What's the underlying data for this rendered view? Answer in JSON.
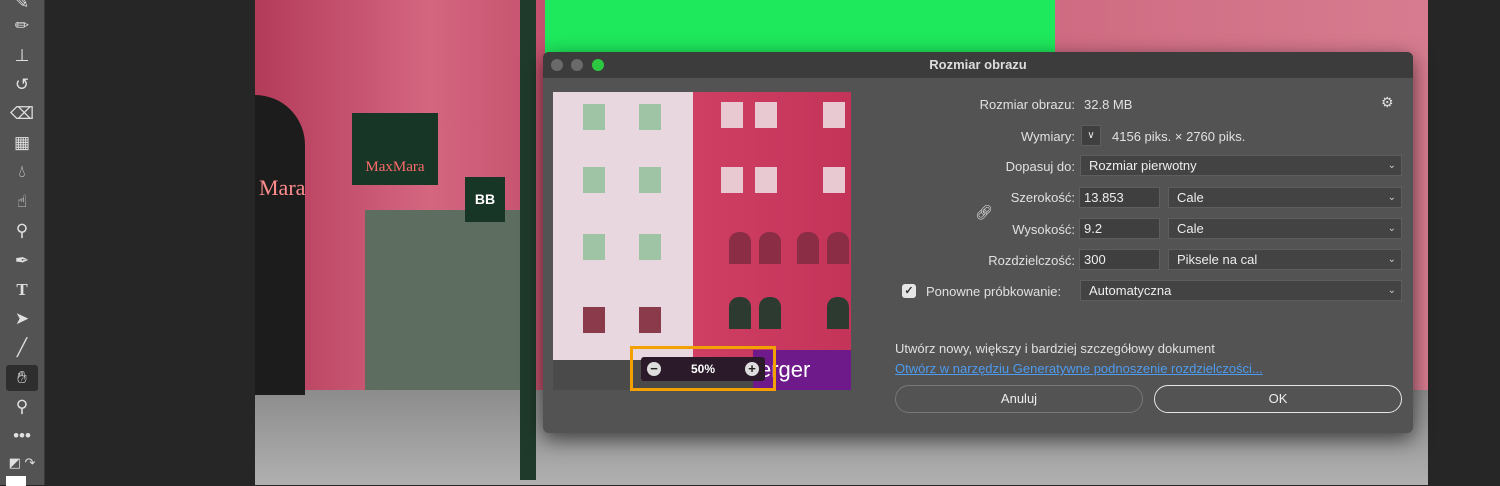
{
  "toolbar": {
    "tools": [
      "brush",
      "pencil",
      "stamp",
      "history-brush",
      "eraser",
      "gradient",
      "blur",
      "smudge",
      "dodge",
      "pen",
      "type",
      "path-selection",
      "line",
      "hand",
      "zoom",
      "more",
      "swap-colors"
    ],
    "active": "hand",
    "type_glyph": "T"
  },
  "dialog": {
    "title": "Rozmiar obrazu",
    "image_size_label": "Rozmiar obrazu:",
    "image_size_value": "32.8 MB",
    "dimensions_label": "Wymiary:",
    "dimensions_value": "4156 piks. × 2760 piks.",
    "fit_to_label": "Dopasuj do:",
    "fit_to_value": "Rozmiar pierwotny",
    "width_label": "Szerokość:",
    "width_value": "13.853",
    "width_unit": "Cale",
    "height_label": "Wysokość:",
    "height_value": "9.2",
    "height_unit": "Cale",
    "resolution_label": "Rozdzielczość:",
    "resolution_value": "300",
    "resolution_unit": "Piksele na cal",
    "resample_label": "Ponowne próbkowanie:",
    "resample_checked": true,
    "resample_value": "Automatyczna",
    "info_text": "Utwórz nowy, większy i bardziej szczegółowy dokument",
    "link_text": "Otwórz w narzędziu Generatywne podnoszenie rozdzielczości...",
    "cancel_label": "Anuluj",
    "ok_label": "OK",
    "preview_zoom": "50%",
    "preview_sign_text": "erger"
  },
  "canvas": {
    "sign_text": "MaxMara",
    "sign2_text": "BB",
    "arch_text": "Mara"
  },
  "colors": {
    "accent": "#f2a100",
    "link": "#4d9bef",
    "dialog_bg": "#535353"
  }
}
